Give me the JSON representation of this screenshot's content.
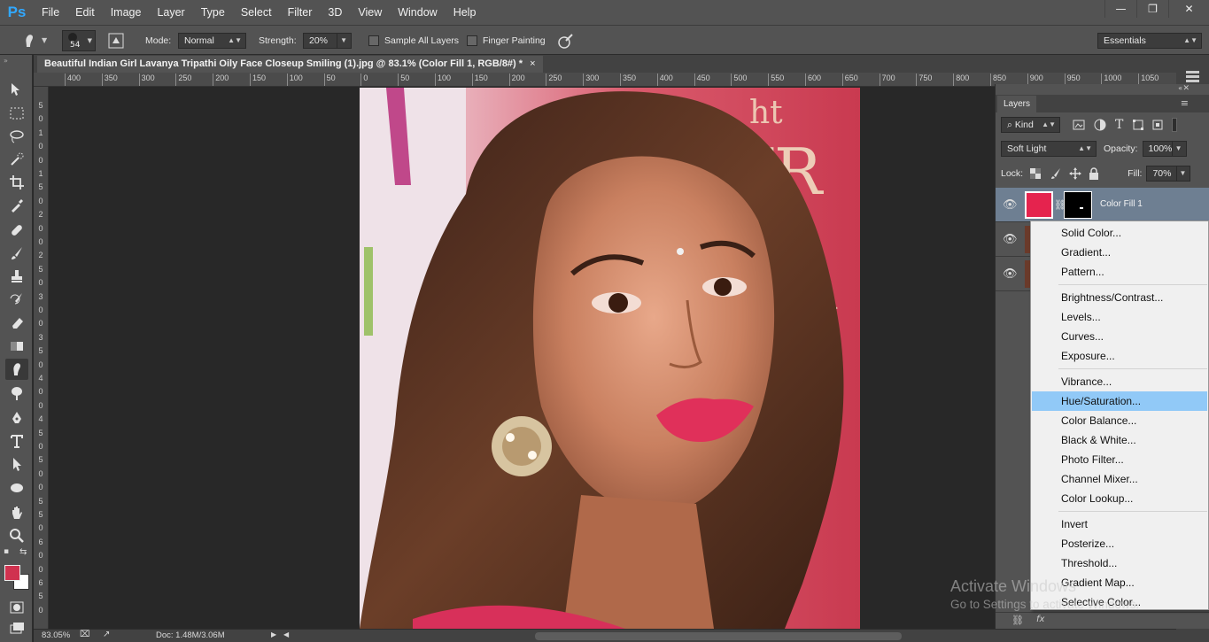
{
  "app": {
    "logo": "Ps"
  },
  "menu": [
    "File",
    "Edit",
    "Image",
    "Layer",
    "Type",
    "Select",
    "Filter",
    "3D",
    "View",
    "Window",
    "Help"
  ],
  "window_controls": {
    "minimize": "—",
    "restore": "❐",
    "close": "✕"
  },
  "options": {
    "brush_size": "54",
    "mode_label": "Mode:",
    "mode_value": "Normal",
    "strength_label": "Strength:",
    "strength_value": "20%",
    "sample_all_layers": "Sample All Layers",
    "finger_painting": "Finger Painting",
    "workspace": "Essentials"
  },
  "document": {
    "tab_title": "Beautiful Indian Girl Lavanya Tripathi Oily Face Closeup Smiling (1).jpg @ 83.1% (Color Fill 1, RGB/8#) *",
    "tab_close": "×"
  },
  "ruler_top": [
    "400",
    "350",
    "300",
    "250",
    "200",
    "150",
    "100",
    "50",
    "0",
    "50",
    "100",
    "150",
    "200",
    "250",
    "300",
    "350",
    "400",
    "450",
    "500",
    "550",
    "600",
    "650",
    "700",
    "750",
    "800",
    "850",
    "900",
    "950",
    "1000",
    "1050"
  ],
  "ruler_left": [
    "5",
    "0",
    "1",
    "0",
    "0",
    "1",
    "5",
    "0",
    "2",
    "0",
    "0",
    "2",
    "5",
    "0",
    "3",
    "0",
    "0",
    "3",
    "5",
    "0",
    "4",
    "0",
    "0",
    "4",
    "5",
    "0",
    "5",
    "0",
    "0",
    "5",
    "5",
    "0",
    "6",
    "0",
    "0",
    "6",
    "5",
    "0"
  ],
  "status": {
    "zoom": "83.05%",
    "doc": "Doc: 1.48M/3.06M"
  },
  "layers": {
    "tab": "Layers",
    "kind": "Kind",
    "blend_mode": "Soft Light",
    "opacity_label": "Opacity:",
    "opacity_value": "100%",
    "lock_label": "Lock:",
    "fill_label": "Fill:",
    "fill_value": "70%",
    "items": [
      {
        "name": "Color Fill 1",
        "color": "#e5234e"
      }
    ]
  },
  "adjustment_menu": {
    "groups": [
      [
        "Solid Color...",
        "Gradient...",
        "Pattern..."
      ],
      [
        "Brightness/Contrast...",
        "Levels...",
        "Curves...",
        "Exposure..."
      ],
      [
        "Vibrance...",
        "Hue/Saturation...",
        "Color Balance...",
        "Black & White...",
        "Photo Filter...",
        "Channel Mixer...",
        "Color Lookup..."
      ],
      [
        "Invert",
        "Posterize...",
        "Threshold...",
        "Gradient Map...",
        "Selective Color..."
      ]
    ],
    "highlighted": "Hue/Saturation..."
  },
  "watermark": {
    "line1": "Activate Windows",
    "line2": "Go to Settings to activate Windows."
  },
  "colors": {
    "foreground": "#d0324f",
    "background": "#ffffff",
    "accent": "#91c9f7"
  }
}
